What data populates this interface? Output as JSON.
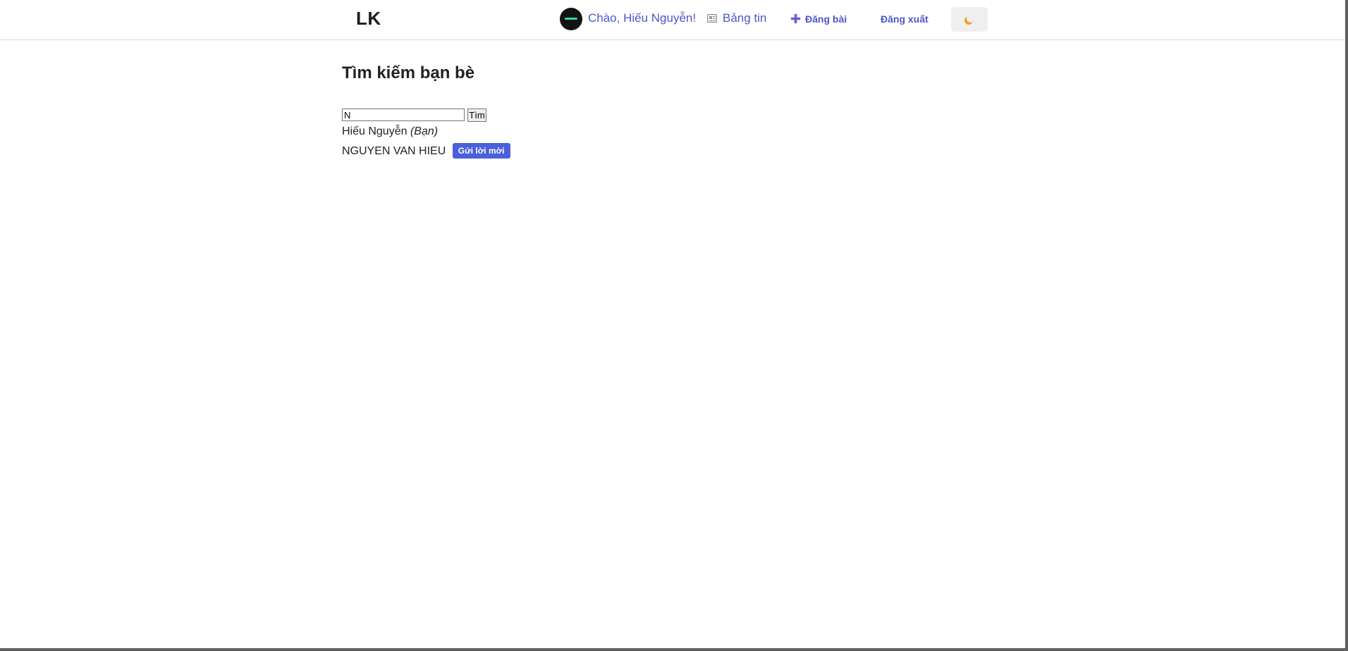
{
  "header": {
    "logo": "LK",
    "greeting": "Chào, Hiếu Nguyễn!",
    "newsfeed_label": "Bảng tin",
    "post_label": "Đăng bài",
    "logout_label": "Đăng xuất",
    "theme_icon": "moon-icon"
  },
  "main": {
    "title": "Tìm kiếm bạn bè",
    "search": {
      "value": "N",
      "button_label": "Tìm"
    },
    "results": [
      {
        "name": "Hiếu Nguyễn",
        "tag": "(Bạn)"
      },
      {
        "name": "NGUYEN VAN HIEU",
        "action_label": "Gửi lời mời"
      }
    ]
  },
  "colors": {
    "link": "#4b57c8",
    "primary_button": "#4a5fdc",
    "accent_avatar": "#34d6b0"
  }
}
